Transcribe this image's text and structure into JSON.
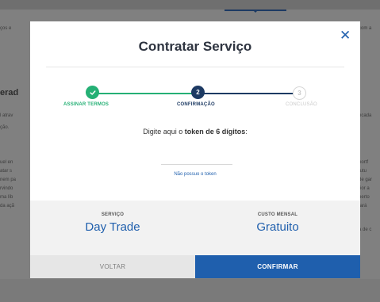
{
  "modal": {
    "title": "Contratar Serviço",
    "close_symbol": "✕",
    "steps": [
      {
        "number": "✓",
        "label": "ASSINAR TERMOS",
        "state": "done"
      },
      {
        "number": "2",
        "label": "CONFIRMAÇÃO",
        "state": "active"
      },
      {
        "number": "3",
        "label": "CONCLUSÃO",
        "state": "pending"
      }
    ],
    "token_prefix": "Digite aqui o ",
    "token_bold": "token de 6 dígitos",
    "token_suffix": ":",
    "token_value": "",
    "cant_token_link": "Não possuo o token",
    "summary": {
      "service_label": "SERVIÇO",
      "service_value": "Day Trade",
      "cost_label": "CUSTO MENSAL",
      "cost_value": "Gratuito"
    },
    "buttons": {
      "back": "VOLTAR",
      "confirm": "CONFIRMAR"
    }
  },
  "background": {
    "fragments_left": [
      "ços e",
      "erad",
      "l atrav",
      "ção.",
      "uel en",
      "atar s",
      "nem pa",
      "rvindo",
      "ma líb",
      "da açã"
    ],
    "fragments_right": [
      "com a",
      "ncada",
      "portf",
      "futu",
      "de gar",
      "rior a",
      "berto",
      "tará",
      "a de c"
    ]
  },
  "colors": {
    "accent": "#1f5fad",
    "step_done": "#25b075",
    "step_active": "#1d3a63",
    "step_pending": "#c9c9c9"
  }
}
